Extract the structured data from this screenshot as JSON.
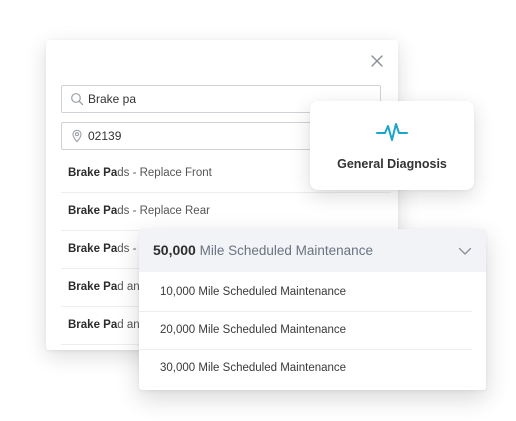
{
  "search_panel": {
    "close_icon": "close-icon",
    "search_field": {
      "icon": "search-icon",
      "value": "Brake pa"
    },
    "zip_field": {
      "icon": "location-pin-icon",
      "value": "02139"
    },
    "results": [
      {
        "match": "Brake Pa",
        "rest": "ds - Replace Front"
      },
      {
        "match": "Brake Pa",
        "rest": "ds - Replace Rear"
      },
      {
        "match": "Brake Pa",
        "rest": "ds - "
      },
      {
        "match": "Brake Pa",
        "rest": "d an"
      },
      {
        "match": "Brake Pa",
        "rest": "d an"
      }
    ]
  },
  "diagnosis_card": {
    "icon": "heartbeat-icon",
    "label": "General Diagnosis",
    "accent_color": "#1aa6c9"
  },
  "maintenance_dropdown": {
    "selected_number": "50,000",
    "selected_rest": "Mile Scheduled Maintenance",
    "chevron_icon": "chevron-down-icon",
    "options": [
      "10,000 Mile Scheduled Maintenance",
      "20,000 Mile Scheduled Maintenance",
      "30,000 Mile Scheduled Maintenance"
    ]
  }
}
